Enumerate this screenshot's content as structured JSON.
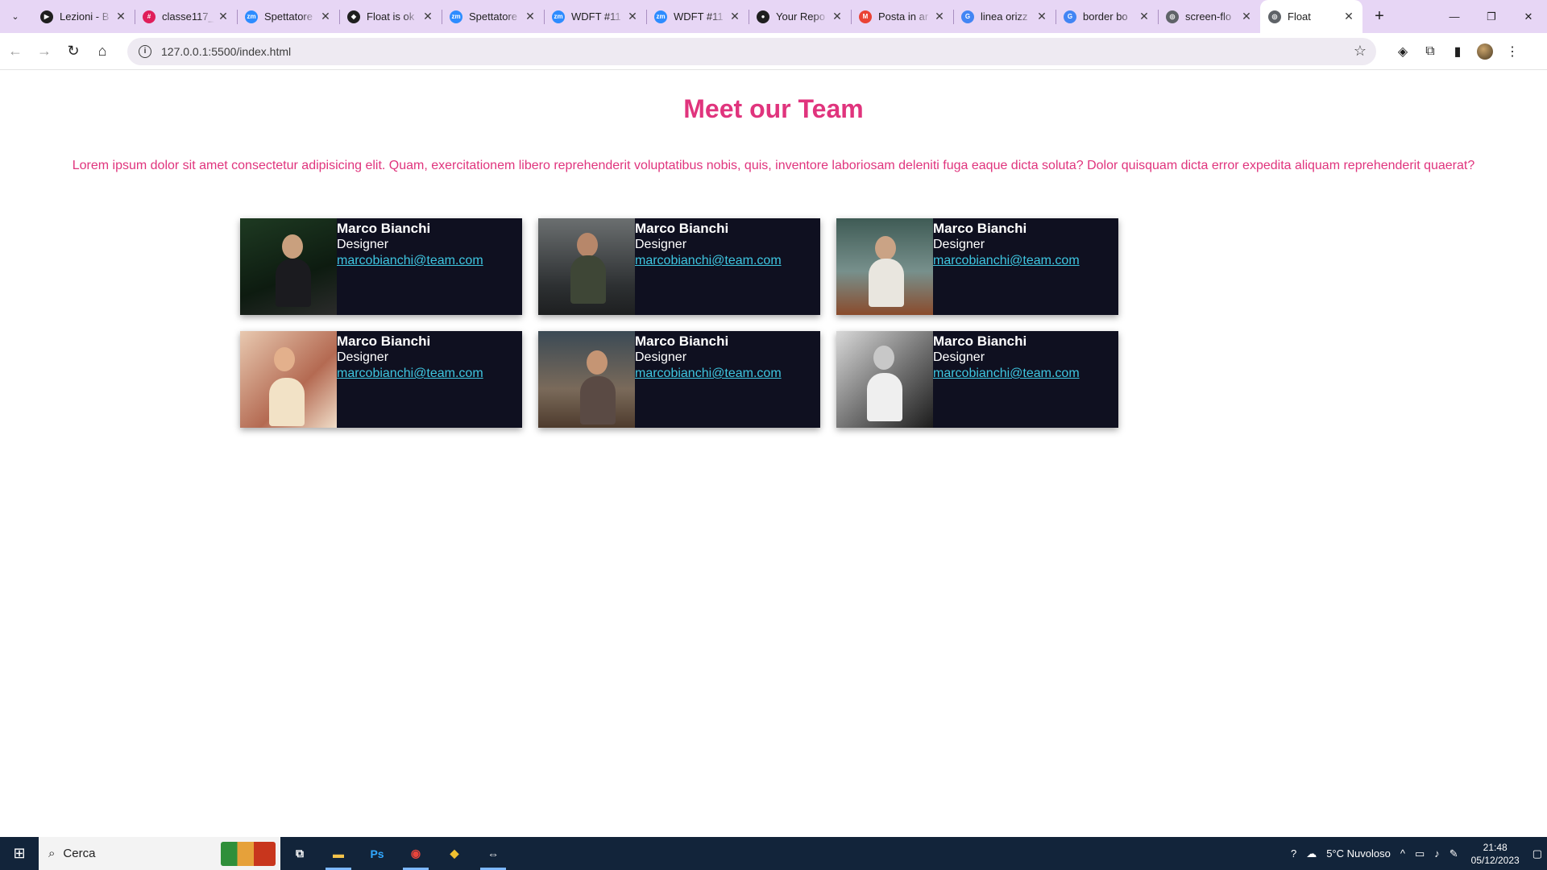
{
  "browser": {
    "tabs": [
      {
        "title": "Lezioni - B",
        "icon": "lezioni-icon",
        "color": "#1f1f1f"
      },
      {
        "title": "classe117_",
        "icon": "slack-icon",
        "color": "#e01e5a"
      },
      {
        "title": "Spettatore",
        "icon": "zoom-icon",
        "color": "#2d8cff"
      },
      {
        "title": "Float is ok",
        "icon": "codepen-icon",
        "color": "#1f1f1f"
      },
      {
        "title": "Spettatore",
        "icon": "zoom-icon",
        "color": "#2d8cff"
      },
      {
        "title": "WDFT #11",
        "icon": "zoom-icon",
        "color": "#2d8cff"
      },
      {
        "title": "WDFT #11",
        "icon": "zoom-icon",
        "color": "#2d8cff"
      },
      {
        "title": "Your Repo",
        "icon": "github-icon",
        "color": "#1f1f1f"
      },
      {
        "title": "Posta in ar",
        "icon": "gmail-icon",
        "color": "#ea4335"
      },
      {
        "title": "linea orizz",
        "icon": "google-icon",
        "color": "#4285f4"
      },
      {
        "title": "border bo",
        "icon": "google-icon",
        "color": "#4285f4"
      },
      {
        "title": "screen-flo",
        "icon": "globe-icon",
        "color": "#5f6368"
      },
      {
        "title": "Float",
        "icon": "globe-icon",
        "color": "#5f6368",
        "active": true
      }
    ],
    "url": "127.0.0.1:5500/index.html"
  },
  "page": {
    "title": "Meet our Team",
    "intro": "Lorem ipsum dolor sit amet consectetur adipisicing elit. Quam, exercitationem libero reprehenderit voluptatibus nobis, quis, inventore laboriosam deleniti fuga eaque dicta soluta? Dolor quisquam dicta error expedita aliquam reprehenderit quaerat?",
    "cards": [
      {
        "name": "Marco Bianchi",
        "role": "Designer",
        "email": "marcobianchi@team.com"
      },
      {
        "name": "Marco Bianchi",
        "role": "Designer",
        "email": "marcobianchi@team.com"
      },
      {
        "name": "Marco Bianchi",
        "role": "Designer",
        "email": "marcobianchi@team.com"
      },
      {
        "name": "Marco Bianchi",
        "role": "Designer",
        "email": "marcobianchi@team.com"
      },
      {
        "name": "Marco Bianchi",
        "role": "Designer",
        "email": "marcobianchi@team.com"
      },
      {
        "name": "Marco Bianchi",
        "role": "Designer",
        "email": "marcobianchi@team.com"
      }
    ]
  },
  "taskbar": {
    "search_placeholder": "Cerca",
    "weather": "5°C  Nuvoloso",
    "time": "21:48",
    "date": "05/12/2023"
  },
  "colors": {
    "accent": "#e0347d",
    "card_bg": "#0f1020",
    "link": "#3ec6e0"
  }
}
